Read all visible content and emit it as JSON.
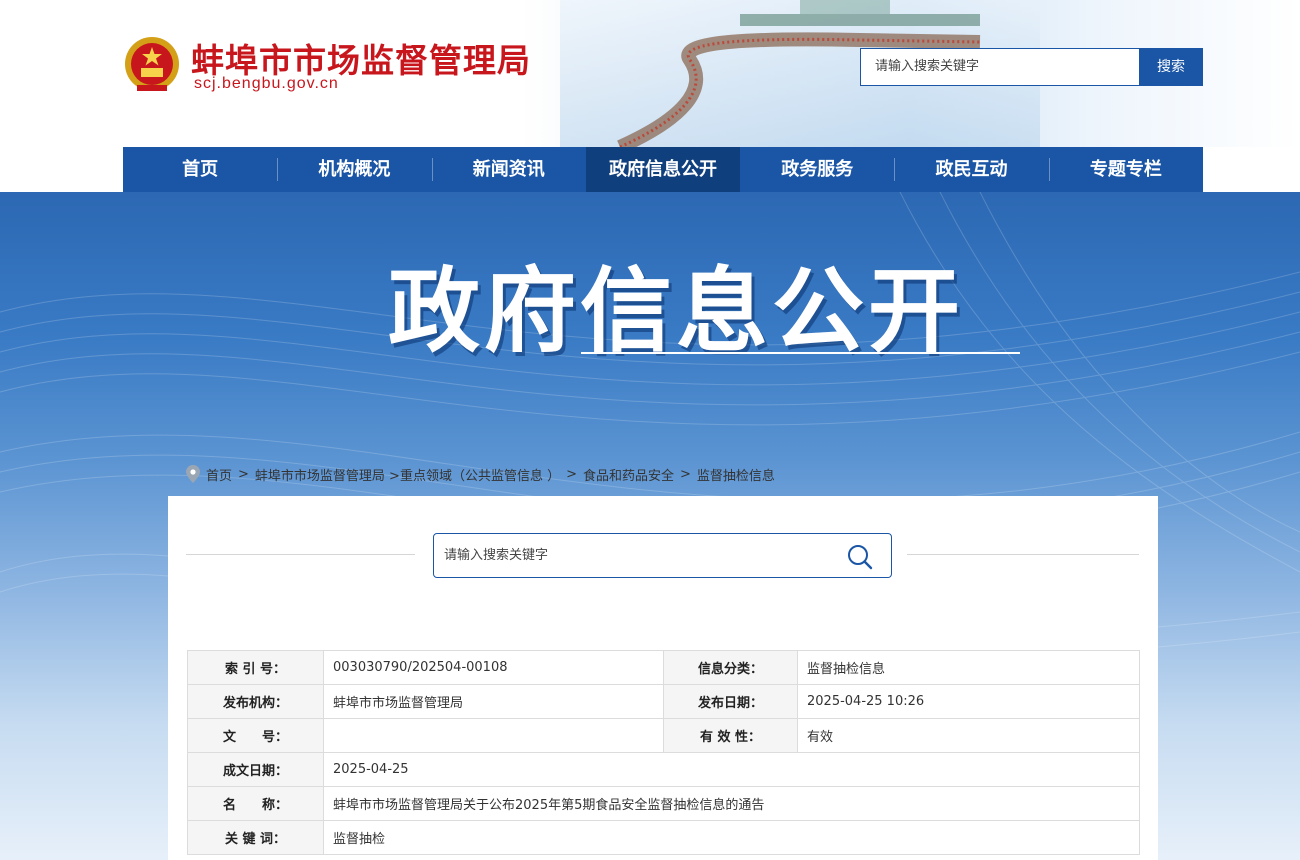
{
  "header": {
    "site_title": "蚌埠市市场监督管理局",
    "site_domain": "scj.bengbu.gov.cn",
    "search_placeholder": "请输入搜索关键字",
    "search_button": "搜索",
    "brand_color": "#c8161d",
    "accent_color": "#1b56a6"
  },
  "nav": {
    "items": [
      {
        "label": "首页"
      },
      {
        "label": "机构概况"
      },
      {
        "label": "新闻资讯"
      },
      {
        "label": "政府信息公开",
        "active": true
      },
      {
        "label": "政务服务"
      },
      {
        "label": "政民互动"
      },
      {
        "label": "专题专栏"
      }
    ]
  },
  "banner": {
    "title": "政府信息公开"
  },
  "breadcrumb": {
    "icon": "location-pin-icon",
    "items": [
      "首页",
      "蚌埠市市场监督管理局 >重点领域（公共监管信息 ）",
      "食品和药品安全",
      "监督抽检信息"
    ],
    "separator": ">"
  },
  "content": {
    "search_placeholder": "请输入搜索关键字",
    "search_icon": "search-icon",
    "meta_table": {
      "index_label": "索 引 号：",
      "index_value": "003030790/202504-00108",
      "category_label": "信息分类：",
      "category_value": "监督抽检信息",
      "publisher_label": "发布机构：",
      "publisher_value": "蚌埠市市场监督管理局",
      "pubdate_label": "发布日期：",
      "pubdate_value": "2025-04-25 10:26",
      "docno_label": "文　　号：",
      "docno_value": "",
      "validity_label": "有 效 性：",
      "validity_value": "有效",
      "created_label": "成文日期：",
      "created_value": "2025-04-25",
      "name_label": "名　　称：",
      "name_value": "蚌埠市市场监督管理局关于公布2025年第5期食品安全监督抽检信息的通告",
      "keywords_label": "关 键 词：",
      "keywords_value": "监督抽检"
    }
  }
}
